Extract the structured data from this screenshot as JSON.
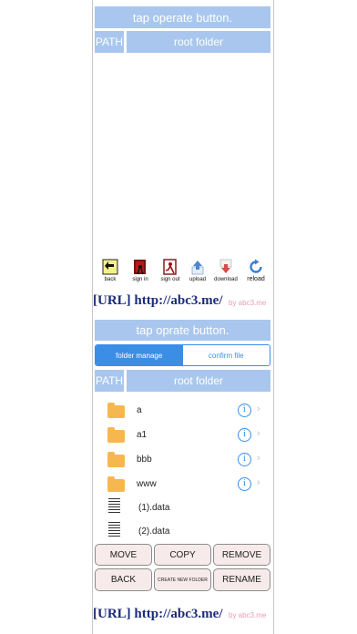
{
  "top": {
    "status": "tap operate button.",
    "path_label": "PATH",
    "path_value": "root folder",
    "toolbar": [
      {
        "label": "back",
        "icon": "back-arrow-icon"
      },
      {
        "label": "sign in",
        "icon": "sign-in-icon"
      },
      {
        "label": "sign out",
        "icon": "sign-out-icon"
      },
      {
        "label": "upload",
        "icon": "upload-icon"
      },
      {
        "label": "download",
        "icon": "download-icon"
      },
      {
        "label": "reload",
        "icon": "reload-icon"
      }
    ],
    "url": "[URL] http://abc3.me/",
    "by": "by abc3.me"
  },
  "bottom": {
    "status": "tap oprate button.",
    "tabs": {
      "active": "folder manage",
      "other": "confirm file"
    },
    "path_label": "PATH",
    "path_value": "root folder",
    "items": [
      {
        "name": "a",
        "type": "folder"
      },
      {
        "name": "a1",
        "type": "folder"
      },
      {
        "name": "bbb",
        "type": "folder"
      },
      {
        "name": "www",
        "type": "folder"
      },
      {
        "name": "(1).data",
        "type": "file"
      },
      {
        "name": "(2).data",
        "type": "file"
      }
    ],
    "info_glyph": "i",
    "chevron_glyph": "›",
    "buttons": {
      "move": "MOVE",
      "copy": "COPY",
      "remove": "REMOVE",
      "back": "BACK",
      "create": "CREATE NEW FOLDER",
      "rename": "RENAME"
    },
    "url": "[URL] http://abc3.me/",
    "by": "by abc3.me"
  },
  "colors": {
    "bar": "#a9c7ee",
    "accent": "#3a8ee6",
    "url": "#1c2c7a",
    "button_bg": "#f7eaea"
  }
}
